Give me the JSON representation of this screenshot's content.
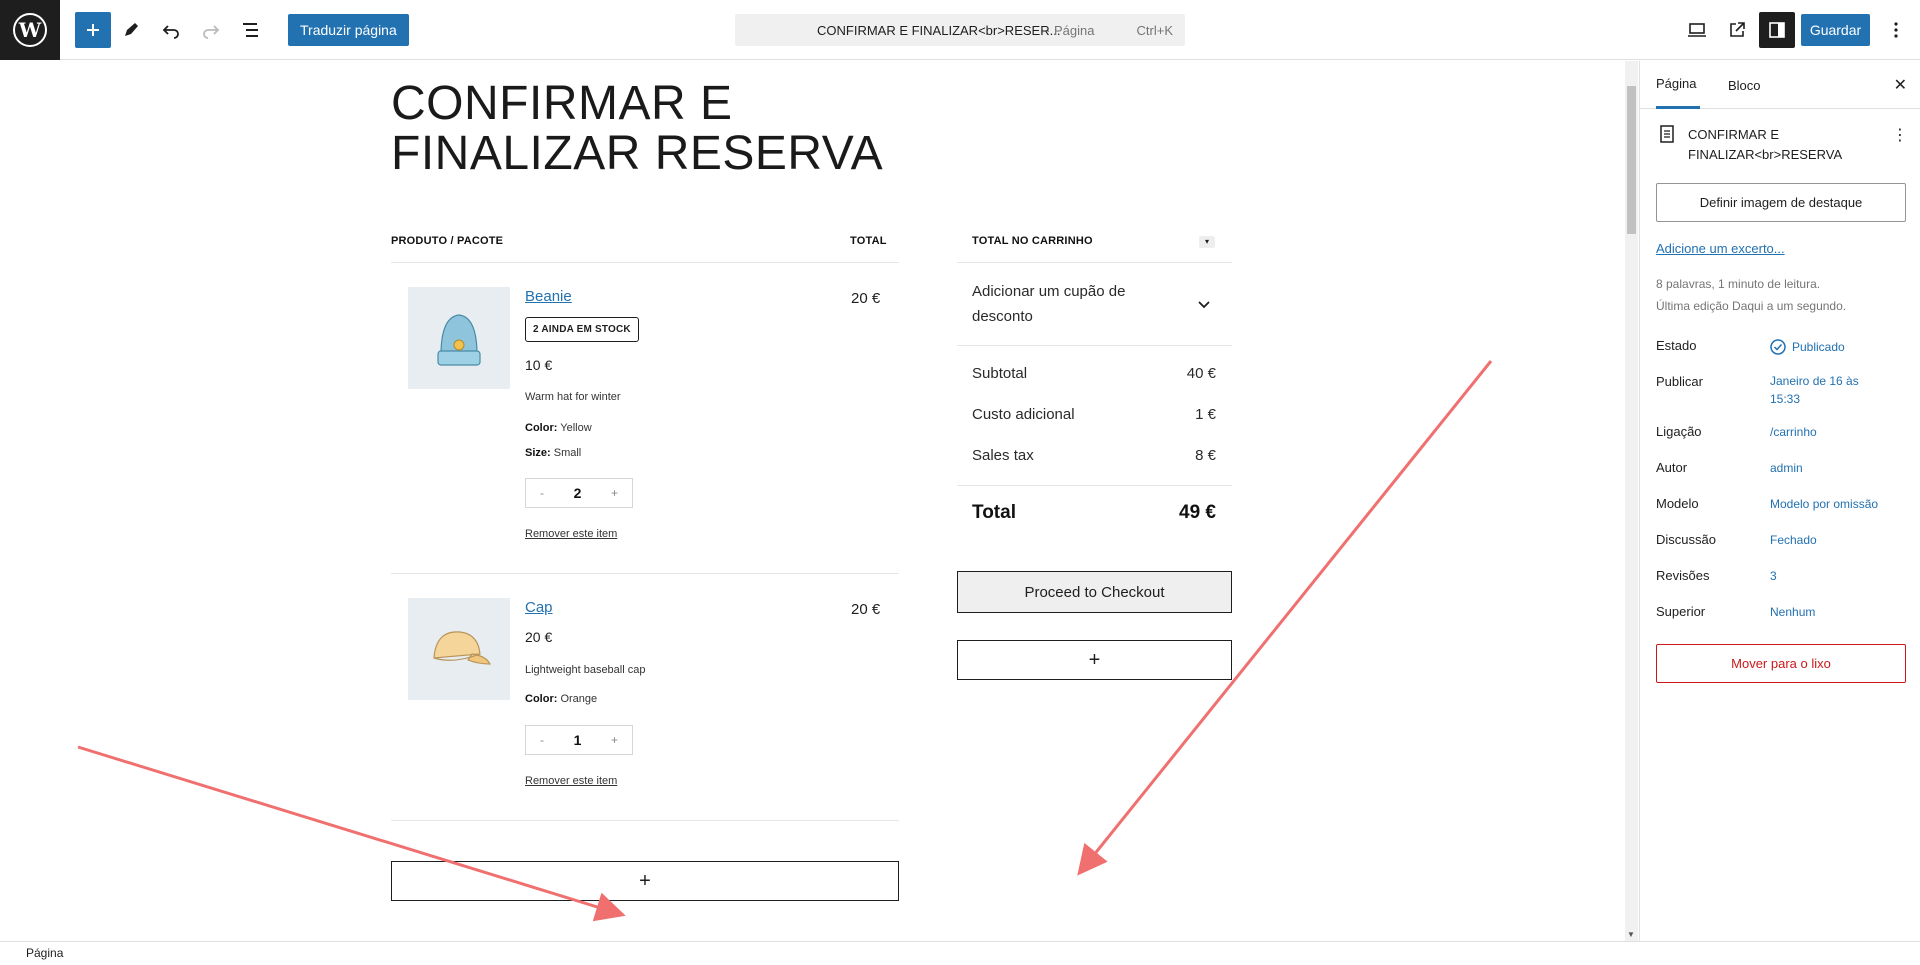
{
  "toolbar": {
    "translate_label": "Traduzir página",
    "doc_title": "CONFIRMAR E FINALIZAR<br>RESER...",
    "doc_type": "· Página",
    "shortcut": "Ctrl+K",
    "save_label": "Guardar"
  },
  "page": {
    "title": "CONFIRMAR E FINALIZAR RESERVA"
  },
  "cart": {
    "header_product": "PRODUTO / PACOTE",
    "header_total": "TOTAL",
    "items": [
      {
        "name": "Beanie",
        "stock_badge": "2 AINDA EM STOCK",
        "price": "10 €",
        "description": "Warm hat for winter",
        "color_label": "Color:",
        "color_value": "Yellow",
        "size_label": "Size:",
        "size_value": "Small",
        "quantity": "2",
        "minus": "-",
        "plus": "+",
        "remove_label": "Remover este item",
        "line_total": "20 €"
      },
      {
        "name": "Cap",
        "price": "20 €",
        "description": "Lightweight baseball cap",
        "color_label": "Color:",
        "color_value": "Orange",
        "quantity": "1",
        "minus": "-",
        "plus": "+",
        "remove_label": "Remover este item",
        "line_total": "20 €"
      }
    ],
    "add_block": "+"
  },
  "totals": {
    "header": "TOTAL NO CARRINHO",
    "coupon_label": "Adicionar um cupão de desconto",
    "rows": [
      {
        "label": "Subtotal",
        "value": "40 €"
      },
      {
        "label": "Custo adicional",
        "value": "1 €"
      },
      {
        "label": "Sales tax",
        "value": "8 €"
      }
    ],
    "grand_label": "Total",
    "grand_value": "49 €",
    "checkout_label": "Proceed to Checkout",
    "add_block": "+"
  },
  "sidebar": {
    "tab_page": "Página",
    "tab_block": "Bloco",
    "page_title": "CONFIRMAR E FINALIZAR<br>RESERVA",
    "featured_label": "Definir imagem de destaque",
    "excerpt_label": "Adicione um excerto...",
    "info_line1": "8 palavras, 1 minuto de leitura.",
    "info_line2": "Última edição Daqui a um segundo.",
    "fields": [
      {
        "label": "Estado",
        "value": "Publicado"
      },
      {
        "label": "Publicar",
        "value": "Janeiro de 16 às 15:33"
      },
      {
        "label": "Ligação",
        "value": "/carrinho"
      },
      {
        "label": "Autor",
        "value": "admin"
      },
      {
        "label": "Modelo",
        "value": "Modelo por omissão"
      },
      {
        "label": "Discussão",
        "value": "Fechado"
      },
      {
        "label": "Revisões",
        "value": "3"
      },
      {
        "label": "Superior",
        "value": "Nenhum"
      }
    ],
    "trash_label": "Mover para o lixo"
  },
  "footer": {
    "breadcrumb": "Página"
  },
  "colors": {
    "accent": "#2271b1",
    "annotation_arrow": "#f07070",
    "danger": "#cc1818"
  }
}
